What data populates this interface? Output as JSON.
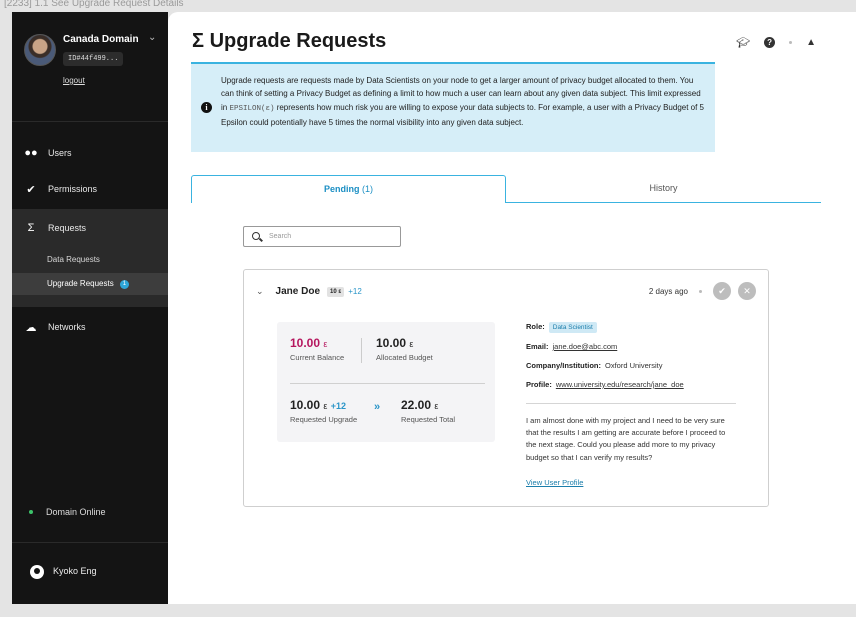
{
  "caption": "[2233] 1.1 See Upgrade Request Details",
  "sidebar": {
    "domain_name": "Canada Domain",
    "domain_id": "ID#44f499...",
    "logout": "logout",
    "nav": {
      "users": "Users",
      "permissions": "Permissions",
      "requests": "Requests",
      "data_requests": "Data Requests",
      "upgrade_requests": "Upgrade Requests",
      "upgrade_count": "1",
      "networks": "Networks"
    },
    "status": "Domain Online",
    "user_name": "Kyoko Eng"
  },
  "main": {
    "title": "Upgrade Requests",
    "title_icon": "Σ",
    "info": {
      "part1": "Upgrade requests are requests made by Data Scientists on your node to get a larger amount of privacy budget allocated to them. You can think of setting a Privacy Budget as defining a limit to how much a user can learn about any given data subject. This limit expressed in ",
      "code": "EPSILON(ε)",
      "part2": " represents how much risk you are willing to expose your data subjects to. For example, a user with a Privacy Budget of 5 Epsilon could potentially have 5 times the normal visibility into any given data subject."
    },
    "tabs": {
      "pending": "Pending",
      "pending_count": "(1)",
      "history": "History"
    },
    "search_placeholder": "Search",
    "request": {
      "name": "Jane Doe",
      "eps_pill": "10 ε",
      "plus": "+12",
      "time": "2 days ago",
      "current_balance_value": "10.00",
      "current_balance_label": "Current Balance",
      "allocated_value": "10.00",
      "allocated_label": "Allocated Budget",
      "requested_value": "10.00",
      "requested_plus": "+12",
      "requested_label": "Requested Upgrade",
      "total_value": "22.00",
      "total_label": "Requested Total",
      "epsilon_symbol": "ε",
      "arrows": "»",
      "role_label": "Role:",
      "role": "Data Scientist",
      "email_label": "Email:",
      "email": "jane.doe@abc.com",
      "company_label": "Company/Institution:",
      "company": "Oxford University",
      "profile_label": "Profile:",
      "profile": "www.university.edu/research/jane_doe",
      "message": "I am almost done with my project and I need to be very sure that the results I am getting are accurate before I proceed to the next stage. Could you please add more to my privacy budget so that I can verify my results?",
      "view_profile": "View User Profile"
    }
  },
  "colors": {
    "accent": "#3ab3e0",
    "highlight_value": "#b5165e",
    "sidebar_bg": "#141414",
    "info_bg": "#d6eef8"
  }
}
